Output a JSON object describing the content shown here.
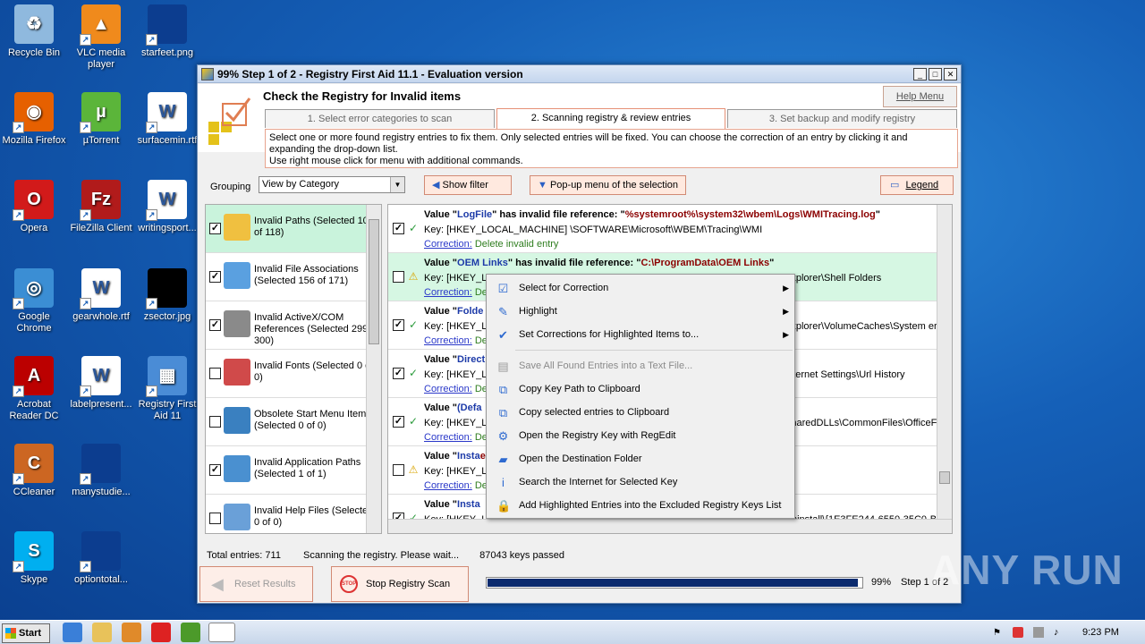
{
  "desktop": {
    "icons": [
      {
        "label": "Recycle Bin"
      },
      {
        "label": "VLC media player"
      },
      {
        "label": "starfeet.png"
      },
      {
        "label": "Mozilla Firefox"
      },
      {
        "label": "µTorrent"
      },
      {
        "label": "surfacemin.rtf"
      },
      {
        "label": "Opera"
      },
      {
        "label": "FileZilla Client"
      },
      {
        "label": "writingsport..."
      },
      {
        "label": "Google Chrome"
      },
      {
        "label": "gearwhole.rtf"
      },
      {
        "label": "zsector.jpg"
      },
      {
        "label": "Acrobat Reader DC"
      },
      {
        "label": "labelpresent..."
      },
      {
        "label": "Registry First Aid 11"
      },
      {
        "label": "CCleaner"
      },
      {
        "label": "manystudie..."
      },
      {
        "label": "Skype"
      },
      {
        "label": "optiontotal..."
      }
    ]
  },
  "window": {
    "title": "99% Step 1 of 2 - Registry First Aid 11.1 - Evaluation version",
    "header": "Check the Registry for Invalid items",
    "help_label": "Help Menu",
    "tabs": [
      "1. Select error categories to scan",
      "2. Scanning registry & review entries",
      "3. Set backup and modify registry"
    ],
    "instructions": [
      "Select one or more found registry entries to fix them. Only selected entries will be fixed. You can choose the correction of an entry by clicking it and expanding the drop-down list.",
      "Use right mouse click for menu with additional commands."
    ],
    "grouping_label": "Grouping",
    "grouping_value": "View by Category",
    "show_filter": "Show filter",
    "popup_menu": "Pop-up menu of the selection",
    "legend": "Legend"
  },
  "categories": [
    {
      "label": "Invalid Paths (Selected 102 of 118)",
      "checked": "✓"
    },
    {
      "label": "Invalid File Associations (Selected 156 of 171)",
      "checked": "✓"
    },
    {
      "label": "Invalid ActiveX/COM References (Selected 299 of 300)",
      "checked": "✓"
    },
    {
      "label": "Invalid Fonts (Selected 0 of 0)",
      "checked": ""
    },
    {
      "label": "Obsolete Start Menu Items (Selected 0 of 0)",
      "checked": ""
    },
    {
      "label": "Invalid Application Paths (Selected 1 of 1)",
      "checked": "✓"
    },
    {
      "label": "Invalid Help Files (Selected 0 of 0)",
      "checked": ""
    }
  ],
  "entries": [
    {
      "v1": "Value \"",
      "name": "LogFile",
      "v2": "\" has invalid file reference: \"",
      "path": "%systemroot%\\system32\\wbem\\Logs\\WMITracing.log",
      "v3": "\"",
      "key": "Key: [HKEY_LOCAL_MACHINE] \\SOFTWARE\\Microsoft\\WBEM\\Tracing\\WMI",
      "corr_label": "Correction:",
      "corr_value": "Delete invalid entry",
      "checked": "✓",
      "status": "✓"
    },
    {
      "v1": "Value \"",
      "name": "OEM Links",
      "v2": "\" has invalid file reference: \"",
      "path": "C:\\ProgramData\\OEM Links",
      "v3": "\"",
      "key": "Key: [HKEY_LOCAL_MACHINE] \\SOFTWARE\\Microsoft\\Windows\\CurrentVersion\\Explorer\\Shell Folders",
      "corr_label": "Correction:",
      "corr_value": "Delete invalid entry",
      "checked": "",
      "status": "⚠"
    },
    {
      "v1": "Value \"",
      "name": "Folde",
      "v2": "",
      "path": "",
      "v3": "",
      "key": "Key: [HKEY_LOCAL_MACHINE] \\SOFTWARE\\Microsoft\\Windows\\CurrentVersion\\Explorer\\VolumeCaches\\System error m",
      "corr_label": "Correction:",
      "corr_value": "Delete invalid entry",
      "checked": "✓",
      "status": "✓"
    },
    {
      "v1": "Value \"",
      "name": "Direct",
      "v2": "",
      "path": "",
      "v3": "",
      "key": "Key: [HKEY_LOCAL_MACHINE] \\SOFTWARE\\Microsoft\\Windows\\CurrentVersion\\Internet Settings\\Url History",
      "corr_label": "Correction:",
      "corr_value": "Delete invalid entry",
      "checked": "✓",
      "status": "✓"
    },
    {
      "v1": "Value \"",
      "name": "(Defa",
      "v2": "",
      "path": "",
      "v3": "",
      "key": "Key: [HKEY_LOCAL_MACHINE] \\SOFTWARE\\Microsoft\\Windows\\CurrentVersion\\SharedDLLs\\CommonFiles\\OfficeFiles\\Sys",
      "corr_label": "Correction:",
      "corr_value": "Delete invalid entry",
      "checked": "✓",
      "status": "✓"
    },
    {
      "v1": "Value \"",
      "name": "Insta",
      "v2": "",
      "path": "esktop\\0001-6305_Vista_Wi",
      "v3": "",
      "key": "Key: [HKEY_LOCAL_MACHINE]",
      "corr_label": "Correction:",
      "corr_value": "Delete invalid entry",
      "checked": "",
      "status": "⚠"
    },
    {
      "v1": "Value \"",
      "name": "Insta",
      "v2": "",
      "path": "",
      "v3": "",
      "key": "Key: [HKEY_LOCAL_MACHINE] \\SOFTWARE\\Microsoft\\Windows\\CurrentVersion\\Uninstall\\{1E3FE244-6550-35C0-BA59-6",
      "corr_label": "Correction:",
      "corr_value": "Delete invalid entry",
      "checked": "✓",
      "status": "✓"
    }
  ],
  "context_menu": [
    {
      "label": "Select for Correction",
      "icon": "check-icon",
      "submenu": true,
      "disabled": false
    },
    {
      "label": "Highlight",
      "icon": "pen-icon",
      "submenu": true,
      "disabled": false
    },
    {
      "label": "Set Corrections for Highlighted Items to...",
      "icon": "checkmark-icon",
      "submenu": true,
      "disabled": false
    },
    {
      "separator": true
    },
    {
      "label": "Save All Found Entries into a Text File...",
      "icon": "save-icon",
      "submenu": false,
      "disabled": true
    },
    {
      "label": "Copy Key Path to Clipboard",
      "icon": "copy-icon",
      "submenu": false,
      "disabled": false
    },
    {
      "label": "Copy selected entries to Clipboard",
      "icon": "copy-icon",
      "submenu": false,
      "disabled": false
    },
    {
      "label": "Open the Registry Key with RegEdit",
      "icon": "regedit-icon",
      "submenu": false,
      "disabled": false
    },
    {
      "label": "Open the Destination Folder",
      "icon": "folder-icon",
      "submenu": false,
      "disabled": false
    },
    {
      "label": "Search the Internet for Selected Key",
      "icon": "info-icon",
      "submenu": false,
      "disabled": false
    },
    {
      "label": "Add Highlighted Entries into the Excluded Registry Keys List",
      "icon": "lock-icon",
      "submenu": false,
      "disabled": false
    }
  ],
  "status": {
    "total": "Total entries: 711",
    "scanning": "Scanning the registry. Please wait...",
    "keys": "87043 keys passed"
  },
  "bottom": {
    "reset": "Reset Results",
    "stop": "Stop Registry Scan",
    "percent": "99%",
    "step": "Step 1 of 2",
    "progress": 0.99
  },
  "taskbar": {
    "start": "Start",
    "time": "9:23 PM"
  },
  "watermark": "ANY RUN"
}
